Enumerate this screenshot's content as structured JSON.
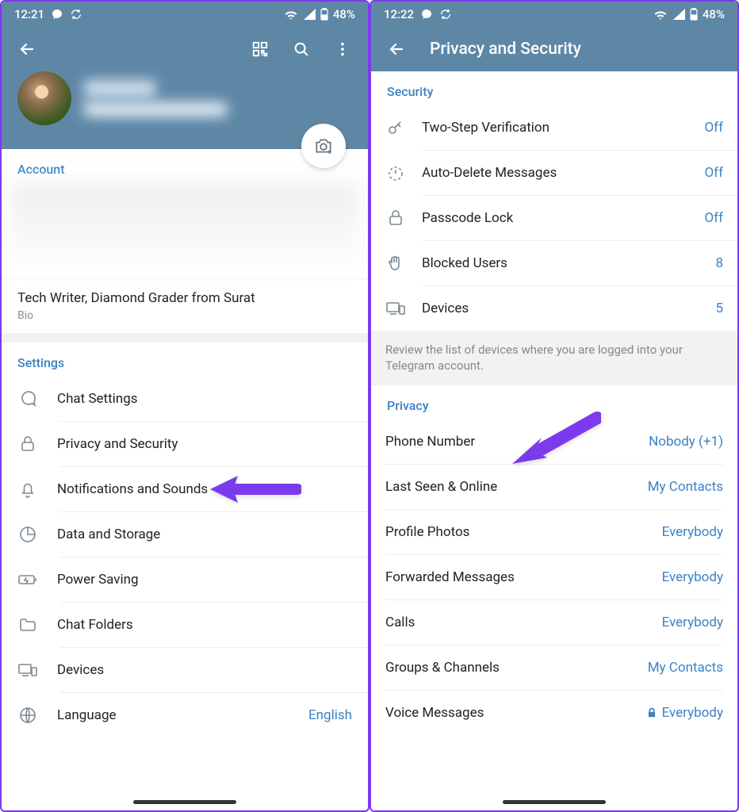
{
  "left": {
    "status": {
      "time": "12:21",
      "battery": "48%"
    },
    "account_header": "Account",
    "bio_text": "Tech Writer, Diamond Grader from Surat",
    "bio_label": "Bio",
    "settings_header": "Settings",
    "items": [
      {
        "label": "Chat Settings"
      },
      {
        "label": "Privacy and Security"
      },
      {
        "label": "Notifications and Sounds"
      },
      {
        "label": "Data and Storage"
      },
      {
        "label": "Power Saving"
      },
      {
        "label": "Chat Folders"
      },
      {
        "label": "Devices"
      },
      {
        "label": "Language",
        "value": "English"
      }
    ]
  },
  "right": {
    "status": {
      "time": "12:22",
      "battery": "48%"
    },
    "title": "Privacy and Security",
    "security_header": "Security",
    "security_rows": [
      {
        "label": "Two-Step Verification",
        "value": "Off"
      },
      {
        "label": "Auto-Delete Messages",
        "value": "Off"
      },
      {
        "label": "Passcode Lock",
        "value": "Off"
      },
      {
        "label": "Blocked Users",
        "value": "8"
      },
      {
        "label": "Devices",
        "value": "5"
      }
    ],
    "devices_note": "Review the list of devices where you are logged into your Telegram account.",
    "privacy_header": "Privacy",
    "privacy_rows": [
      {
        "label": "Phone Number",
        "value": "Nobody (+1)"
      },
      {
        "label": "Last Seen & Online",
        "value": "My Contacts"
      },
      {
        "label": "Profile Photos",
        "value": "Everybody"
      },
      {
        "label": "Forwarded Messages",
        "value": "Everybody"
      },
      {
        "label": "Calls",
        "value": "Everybody"
      },
      {
        "label": "Groups & Channels",
        "value": "My Contacts"
      },
      {
        "label": "Voice Messages",
        "value": "Everybody",
        "locked": true
      }
    ]
  }
}
